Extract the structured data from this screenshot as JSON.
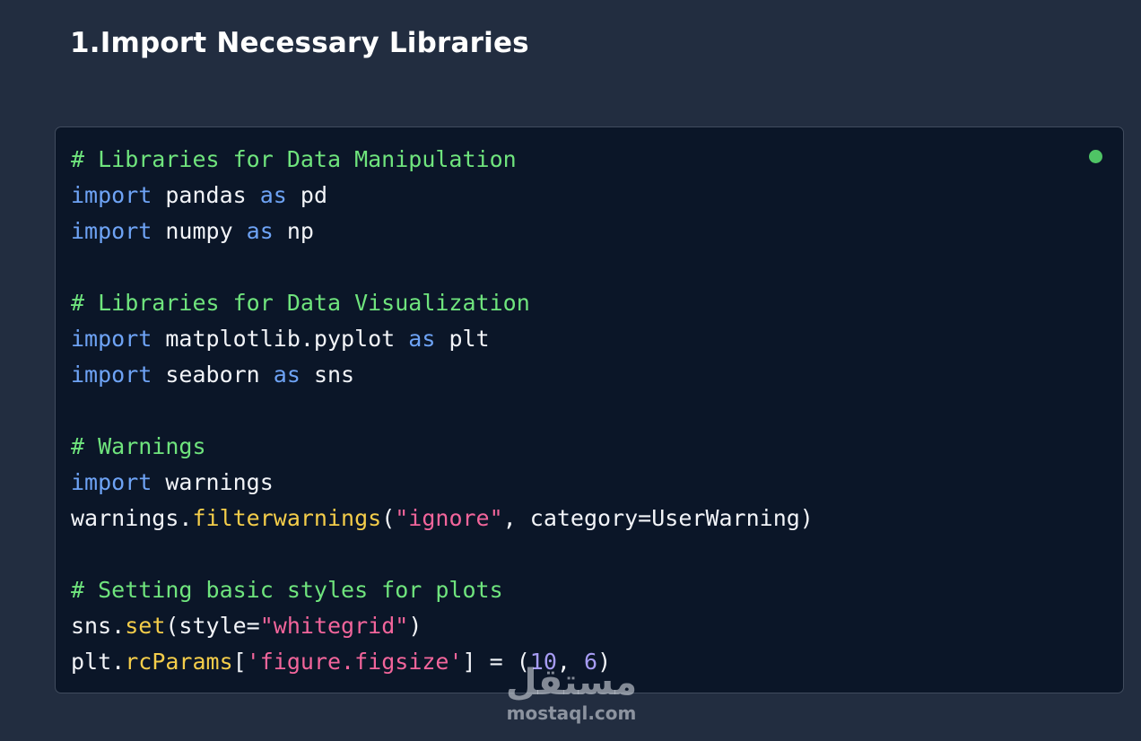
{
  "heading": "1.Import Necessary Libraries",
  "code_panel": {
    "lines": [
      [
        {
          "t": "# Libraries for Data Manipulation",
          "c": "comment"
        }
      ],
      [
        {
          "t": "import",
          "c": "kw"
        },
        {
          "t": " pandas ",
          "c": "plain"
        },
        {
          "t": "as",
          "c": "kw"
        },
        {
          "t": " pd",
          "c": "plain"
        }
      ],
      [
        {
          "t": "import",
          "c": "kw"
        },
        {
          "t": " numpy ",
          "c": "plain"
        },
        {
          "t": "as",
          "c": "kw"
        },
        {
          "t": " np",
          "c": "plain"
        }
      ],
      [],
      [
        {
          "t": "# Libraries for Data Visualization",
          "c": "comment"
        }
      ],
      [
        {
          "t": "import",
          "c": "kw"
        },
        {
          "t": " matplotlib.pyplot ",
          "c": "plain"
        },
        {
          "t": "as",
          "c": "kw"
        },
        {
          "t": " plt",
          "c": "plain"
        }
      ],
      [
        {
          "t": "import",
          "c": "kw"
        },
        {
          "t": " seaborn ",
          "c": "plain"
        },
        {
          "t": "as",
          "c": "kw"
        },
        {
          "t": " sns",
          "c": "plain"
        }
      ],
      [],
      [
        {
          "t": "# Warnings",
          "c": "comment"
        }
      ],
      [
        {
          "t": "import",
          "c": "kw"
        },
        {
          "t": " warnings",
          "c": "plain"
        }
      ],
      [
        {
          "t": "warnings.",
          "c": "plain"
        },
        {
          "t": "filterwarnings",
          "c": "fn"
        },
        {
          "t": "(",
          "c": "plain"
        },
        {
          "t": "\"ignore\"",
          "c": "str"
        },
        {
          "t": ", category=UserWarning)",
          "c": "plain"
        }
      ],
      [],
      [
        {
          "t": "# Setting basic styles for plots",
          "c": "comment"
        }
      ],
      [
        {
          "t": "sns.",
          "c": "plain"
        },
        {
          "t": "set",
          "c": "fn"
        },
        {
          "t": "(style=",
          "c": "plain"
        },
        {
          "t": "\"whitegrid\"",
          "c": "str"
        },
        {
          "t": ")",
          "c": "plain"
        }
      ],
      [
        {
          "t": "plt.",
          "c": "plain"
        },
        {
          "t": "rcParams",
          "c": "fn"
        },
        {
          "t": "[",
          "c": "plain"
        },
        {
          "t": "'figure.figsize'",
          "c": "str"
        },
        {
          "t": "] = (",
          "c": "plain"
        },
        {
          "t": "10",
          "c": "num"
        },
        {
          "t": ", ",
          "c": "plain"
        },
        {
          "t": "6",
          "c": "num"
        },
        {
          "t": ")",
          "c": "plain"
        }
      ]
    ],
    "status_color": "#4fc465"
  },
  "watermark": {
    "logo": "مستقل",
    "domain": "mostaql.com"
  },
  "colors": {
    "background": "#222d40",
    "code_background": "#0b1628",
    "comment": "#6fe47d",
    "keyword": "#6ea3f5",
    "function": "#f4cd4a",
    "string": "#f2659b",
    "number": "#a79cf4",
    "text": "#f2f4f8"
  }
}
